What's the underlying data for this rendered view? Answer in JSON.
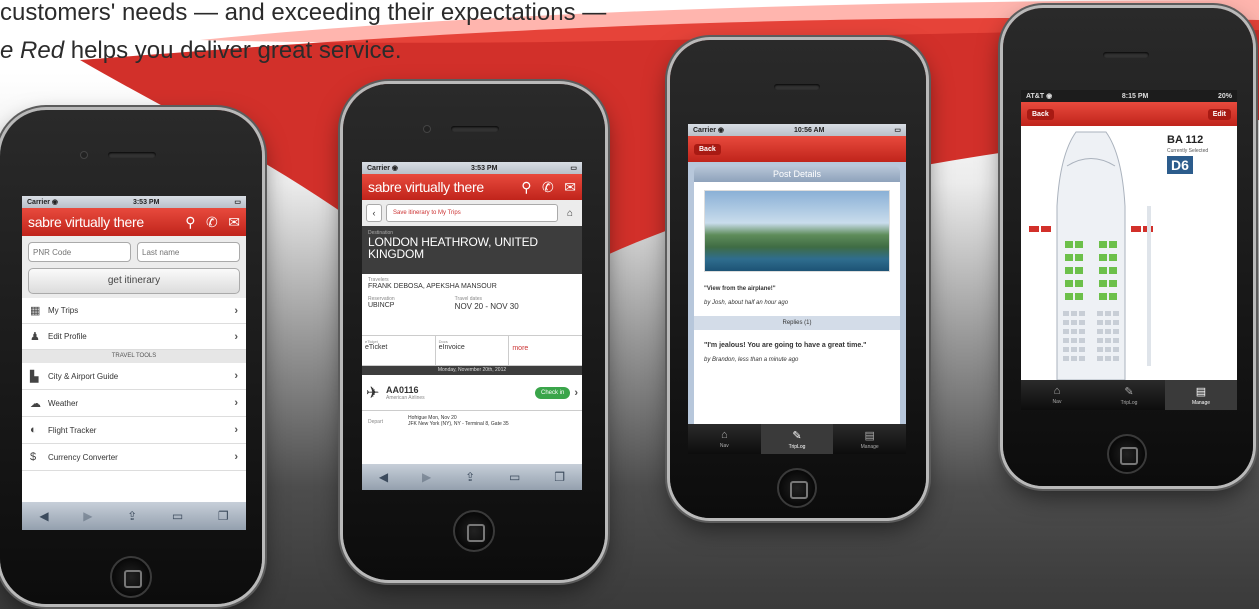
{
  "headline": {
    "line1": "customers' needs — and exceeding their expectations —",
    "line2_em": "e Red",
    "line2_rest": " helps you deliver great service."
  },
  "colors": {
    "brand_red": "#d2302a",
    "seat_green": "#6cc04a"
  },
  "phone1": {
    "status": {
      "carrier": "Carrier ◉",
      "time": "3:53 PM"
    },
    "brand": "sabre virtually there",
    "icons": {
      "pin": "pin-icon",
      "phone": "phone-icon",
      "mail": "mail-icon"
    },
    "pnr_placeholder": "PNR Code",
    "lastname_placeholder": "Last name",
    "get_itinerary": "get itinerary",
    "menu": [
      {
        "label": "My Trips",
        "icon": "calendar-icon"
      },
      {
        "label": "Edit Profile",
        "icon": "person-icon"
      }
    ],
    "section": "TRAVEL TOOLS",
    "tools": [
      {
        "label": "City & Airport Guide",
        "icon": "city-icon"
      },
      {
        "label": "Weather",
        "icon": "cloud-icon"
      },
      {
        "label": "Flight Tracker",
        "icon": "globe-icon"
      },
      {
        "label": "Currency Converter",
        "icon": "currency-icon"
      }
    ]
  },
  "phone2": {
    "status": {
      "carrier": "Carrier ◉",
      "time": "3:53 PM"
    },
    "brand": "sabre virtually there",
    "save_button": "Save itinerary to My Trips",
    "destination_label": "Destination",
    "destination": "LONDON HEATHROW, UNITED KINGDOM",
    "travelers_label": "Travelers",
    "travelers": "FRANK DEBOSA, APEKSHA MANSOUR",
    "reservation_label": "Reservation",
    "reservation": "UBINCP",
    "dates_label": "Travel dates",
    "dates": "NOV 20 - NOV 30",
    "cell1_label": "eTicket",
    "cell1": "eTicket",
    "cell2_label": "Docs",
    "cell2": "eInvoice",
    "cell3": "more",
    "date_bar": "Monday, November 20th, 2012",
    "flight": "AA0116",
    "airline": "American Airlines",
    "checkin": "Check in",
    "depart_label": "Depart",
    "depart_line1": "Hofrigue Mon, Nov 20",
    "depart_line2": "JFK New York (NY), NY - Terminal 8, Gate 35"
  },
  "phone3": {
    "status": {
      "carrier": "Carrier ◉",
      "time": "10:56 AM"
    },
    "back": "Back",
    "title": "Post Details",
    "caption": "\"View from the airplane!\"",
    "meta": "by Josh, about half an hour ago",
    "replies": "Replies (1)",
    "reply": "\"I'm jealous! You are going to have a great time.\"",
    "reply_meta": "by Brandon, less than a minute ago",
    "tabs": [
      {
        "label": "Nav",
        "icon": "home-icon"
      },
      {
        "label": "TripLog",
        "icon": "pencil-icon"
      },
      {
        "label": "Manage",
        "icon": "folder-icon"
      }
    ]
  },
  "phone4": {
    "status": {
      "carrier": "AT&T ◉",
      "time": "8:15 PM",
      "battery": "20%"
    },
    "back": "Back",
    "edit": "Edit",
    "flight": "BA 112",
    "selected_label": "Currently Selected",
    "seat": "D6",
    "tabs": [
      {
        "label": "Nav",
        "icon": "home-icon"
      },
      {
        "label": "TripLog",
        "icon": "pencil-icon"
      },
      {
        "label": "Manage",
        "icon": "folder-icon"
      }
    ]
  }
}
